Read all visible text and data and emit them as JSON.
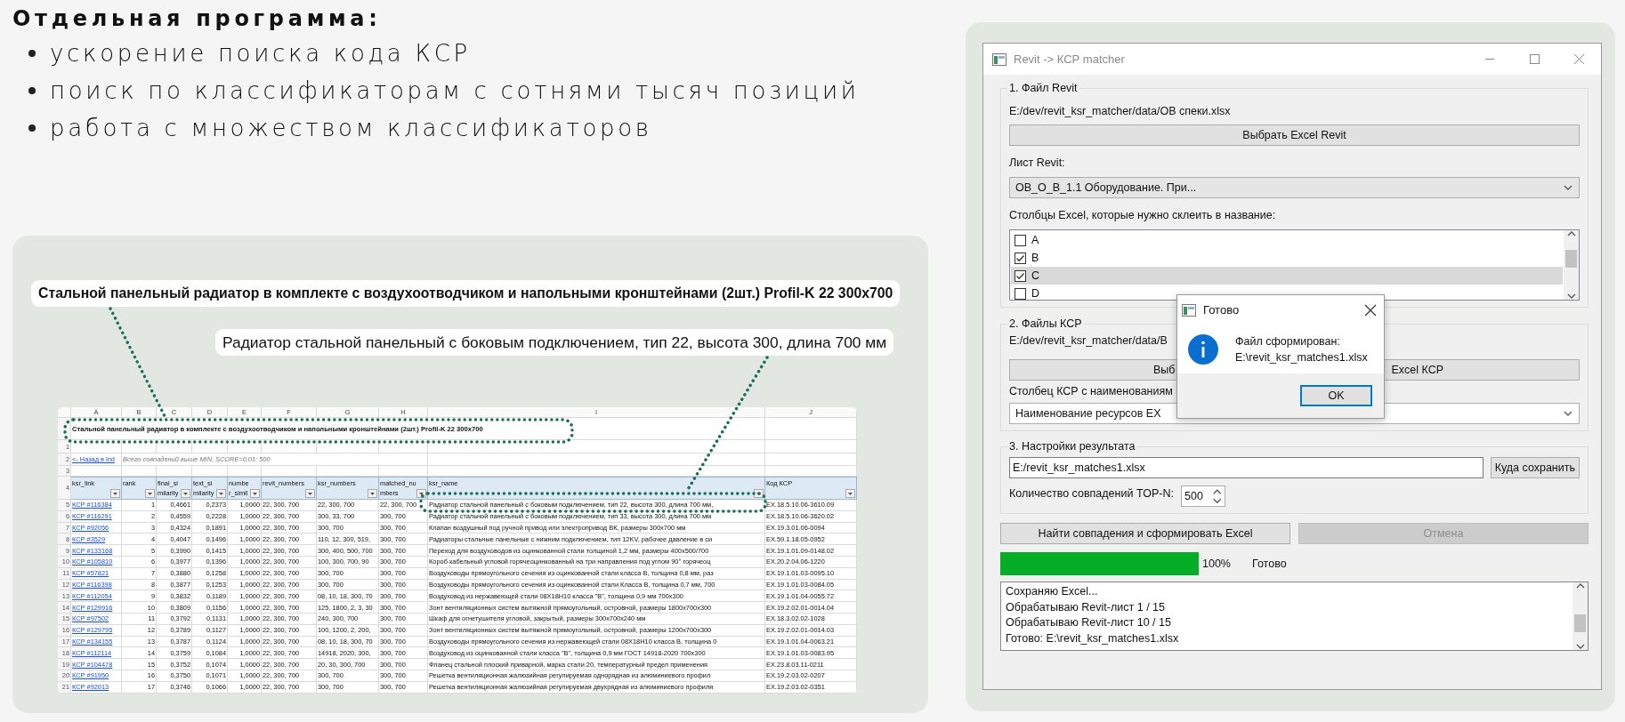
{
  "slide": {
    "title": "Отдельная программа:",
    "bullets": [
      "ускорение поиска кода КСР",
      "поиск по классификаторам с сотнями тысяч позиций",
      "работа с множеством классификаторов"
    ]
  },
  "callouts": [
    {
      "kind": "source",
      "text": "Стальной панельный радиатор в комплекте с воздухоотводчиком и напольными кронштейнами (2шт.) Profil-K 22 300x700"
    },
    {
      "kind": "match",
      "text": "Радиатор стальной панельный с боковым подключением, тип 22, высота 300, длина 700 мм"
    }
  ],
  "spreadsheet": {
    "column_letters": [
      "A",
      "B",
      "C",
      "D",
      "E",
      "F",
      "G",
      "H",
      "I",
      "J"
    ],
    "title": "Стальной панельный радиатор в комплекте с воздухоотводчиком и напольными кронштейнами (2шт.) Profil-K 22 300x700",
    "top_row_numbers": [
      "1",
      "2",
      "3",
      "4"
    ],
    "back_link": "<- Назад в ind",
    "summary": "Всего совпадений выше MIN_SCORE=0.01: 500",
    "columns": [
      "ksr_link",
      "rank",
      "final_similarity",
      "text_similarity",
      "number_simil",
      "revit_numbers",
      "ksr_numbers",
      "matched_numbers",
      "ksr_name",
      "Код КСР"
    ],
    "rows": [
      {
        "row": "5",
        "cells": [
          "КСР #116384",
          "1",
          "0,4661",
          "0,2373",
          "1,0000",
          "22, 300, 700",
          "22, 300, 700",
          "22, 300, 700",
          "Радиатор стальной панельный с боковым подключением, тип 22, высота 300, длина 700 мм,",
          "EX.18.5.10.06-3610.09"
        ]
      },
      {
        "row": "6",
        "cells": [
          "КСР #116291",
          "2",
          "0,4559",
          "0,2228",
          "1,0000",
          "22, 300, 700",
          "300, 33, 700",
          "300, 700",
          "Радиатор стальной панельный с боковым подключением, тип 33, высота 300, длина 700 мм",
          "EX.18.5.10.06-3620.02"
        ]
      },
      {
        "row": "7",
        "cells": [
          "КСР #92056",
          "3",
          "0,4324",
          "0,1891",
          "1,0000",
          "22, 300, 700",
          "300, 700",
          "300, 700",
          "Клапан воздушный под ручной привод или электропривод ВК, размеры 300х700 мм",
          "EX.19.3.01.06-0094"
        ]
      },
      {
        "row": "8",
        "cells": [
          "КСР #3529",
          "4",
          "0,4047",
          "0,1496",
          "1,0000",
          "22, 300, 700",
          "110, 12, 300, 519,",
          "300, 700",
          "Радиаторы стальные панельные с нижним подключением, тип 12KV, рабочее давление в си",
          "EX.59.1.18.05-0952"
        ]
      },
      {
        "row": "9",
        "cells": [
          "КСР #133168",
          "5",
          "0,3990",
          "0,1415",
          "1,0000",
          "22, 300, 700",
          "300, 400, 500, 700",
          "300, 700",
          "Переход для воздуховодов из оцинкованной стали толщиной 1,2 мм, размеры  400х500/700",
          "EX.19.1.01.09-0148.02"
        ]
      },
      {
        "row": "10",
        "cells": [
          "КСР #105810",
          "6",
          "0,3977",
          "0,1396",
          "1,0000",
          "22, 300, 700",
          "100, 300, 700, 90",
          "300, 700",
          "Короб кабельный угловой горячеоцинкованный на три направления под углом 90° горячеоц",
          "EX.20.2.04.06-1220"
        ]
      },
      {
        "row": "11",
        "cells": [
          "КСР #57821",
          "7",
          "0,3880",
          "0,1258",
          "1,0000",
          "22, 300, 700",
          "300, 700",
          "300, 700",
          "Воздуховоды прямоугольного сечения из оцинкованной стали класса В, толщина 0,8 мм, раз",
          "EX.19.1.01.03-0095.10"
        ]
      },
      {
        "row": "12",
        "cells": [
          "КСР #116398",
          "8",
          "0,3877",
          "0,1253",
          "1,0000",
          "22, 300, 700",
          "300, 700",
          "300, 700",
          "Воздуховоды прямоугольного сечения из оцинкованной стали Класса В, толщина 0,7 мм, 700",
          "EX.19.1.01.03-0084.05"
        ]
      },
      {
        "row": "13",
        "cells": [
          "КСР #112054",
          "9",
          "0,3832",
          "0,1189",
          "1,0000",
          "22, 300, 700",
          "08, 10, 18, 300, 70",
          "300, 700",
          "Воздуховод из нержавеющей стали 08Х18Н10 класса \"В\", толщина 0,9 мм 700х300",
          "EX.19.1.01.04-0055.72"
        ]
      },
      {
        "row": "14",
        "cells": [
          "КСР #129916",
          "10",
          "0,3809",
          "0,1156",
          "1,0000",
          "22, 300, 700",
          "125, 1800, 2, 3, 30",
          "300, 700",
          "Зонт вентиляционных систем вытяжной  прямоугольный, островной, размеры 1800х700х300",
          "EX.19.2.02.01-0014.04"
        ]
      },
      {
        "row": "15",
        "cells": [
          "КСР #97502",
          "11",
          "0,3792",
          "0,1131",
          "1,0000",
          "22, 300, 700",
          "240, 300, 700",
          "300, 700",
          "Шкаф для огнетушителя угловой, закрытый, размеры 300х700х240 мм",
          "EX.18.3.02.02-1028"
        ]
      },
      {
        "row": "16",
        "cells": [
          "КСР #129795",
          "12",
          "0,3789",
          "0,1127",
          "1,0000",
          "22, 300, 700",
          "100, 1200, 2, 200,",
          "300, 700",
          "Зонт вентиляционных систем вытяжной  прямоугольный, островной, размеры 1200х700х300",
          "EX.19.2.02.01-0014.03"
        ]
      },
      {
        "row": "17",
        "cells": [
          "КСР #134155",
          "13",
          "0,3787",
          "0,1124",
          "1,0000",
          "22, 300, 700",
          "08, 10, 18, 300, 70",
          "300, 700",
          "Воздуховоды прямоугольного сечения из нержавеющей стали 08Х18Н10 класса В, толщина 0",
          "EX.19.1.01.04-0063.21"
        ]
      },
      {
        "row": "18",
        "cells": [
          "КСР #112114",
          "14",
          "0,3759",
          "0,1084",
          "1,0000",
          "22, 300, 700",
          "14918, 2020, 300,",
          "300, 700",
          "Воздуховод из оцинкованной стали класса \"В\", толщина 0,9 мм ГОСТ 14918-2020 700х300",
          "EX.19.1.01.03-0083.95"
        ]
      },
      {
        "row": "19",
        "cells": [
          "КСР #104478",
          "15",
          "0,3752",
          "0,1074",
          "1,0000",
          "22, 300, 700",
          "20, 30, 300, 700",
          "300, 700",
          "Фланец стальной плоский приварной, марка стали 20, температурный предел применения",
          "EX.23.8.03.11-0211"
        ]
      },
      {
        "row": "20",
        "cells": [
          "КСР #91950",
          "16",
          "0,3750",
          "0,1071",
          "1,0000",
          "22, 300, 700",
          "300, 700",
          "300, 700",
          "Решетка вентиляционная жалюзийная регулируемая однорядная из алюминиевого профил",
          "EX.19.2.03.02-0207"
        ]
      },
      {
        "row": "21",
        "cells": [
          "КСР #92013",
          "17",
          "0,3746",
          "0,1066",
          "1,0000",
          "22, 300, 700",
          "300, 700",
          "300, 700",
          "Решетка вентиляционная жалюзийная регулируемая двухрядная из алюминиевого профиля",
          "EX.19.2.03.02-0351"
        ]
      }
    ]
  },
  "window": {
    "title": "Revit -> КСР matcher",
    "revit_file": {
      "title": "1. Файл Revit",
      "path": "E:/dev/revit_ksr_matcher/data/ОВ спеки.xlsx",
      "button": "Выбрать Excel Revit",
      "sheet_label": "Лист Revit:",
      "sheet_value": "ОВ_О_В_1.1 Оборудование. При...",
      "columns_label": "Столбцы Excel, которые нужно склеить в название:",
      "columns": [
        {
          "label": "A",
          "checked": false,
          "selected": false
        },
        {
          "label": "B",
          "checked": true,
          "selected": false
        },
        {
          "label": "C",
          "checked": true,
          "selected": true
        },
        {
          "label": "D",
          "checked": false,
          "selected": false
        }
      ]
    },
    "ksr_files": {
      "title": "2. Файлы КСР",
      "path": "E:/dev/revit_ksr_matcher/data/B",
      "button_start": "Выб",
      "button_end": "Excel КСР",
      "column_label": "Столбец КСР с наименованиям",
      "column_value": "Наименование ресурсов ЕХ"
    },
    "result": {
      "title": "3. Настройки результата",
      "output_path": "E:/revit_ksr_matches1.xlsx",
      "browse_button": "Куда сохранить",
      "top_n_label": "Количество совпадений TOP-N:",
      "top_n": "500"
    },
    "run_button": "Найти совпадения и сформировать Excel",
    "cancel_button": {
      "label": "Отмена",
      "disabled": true
    },
    "progress": {
      "level": 1,
      "percent": "100%",
      "status": "Готово"
    },
    "log": [
      "Сохраняю Excel...",
      "Обрабатываю Revit-лист 1 / 15",
      "Обрабатываю Revit-лист 10 / 15",
      "Готово: E:\\revit_ksr_matches1.xlsx"
    ]
  },
  "dialog": {
    "title": "Готово",
    "message": [
      "Файл сформирован:",
      "E:\\revit_ksr_matches1.xlsx"
    ],
    "button": "OK"
  }
}
